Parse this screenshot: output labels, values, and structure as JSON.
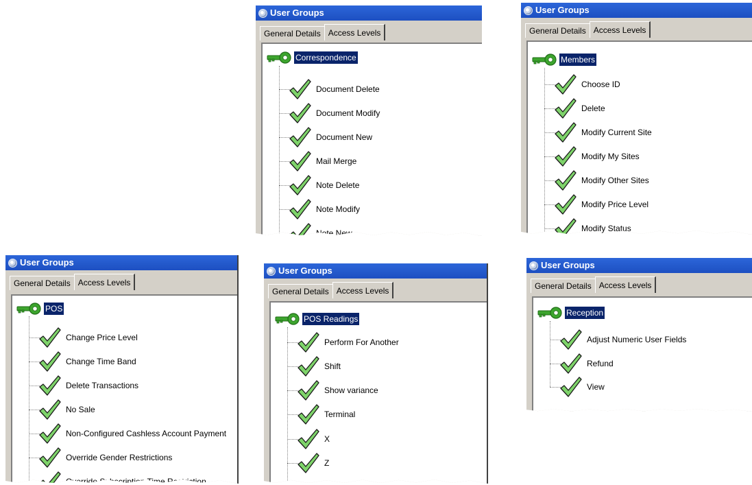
{
  "windows": [
    {
      "id": "correspondence",
      "title": "User Groups",
      "tabs": [
        "General Details",
        "Access Levels"
      ],
      "active_tab": "Access Levels",
      "root": "Correspondence",
      "items": [
        "Document Delete",
        "Document Modify",
        "Document New",
        "Mail Merge",
        "Note Delete",
        "Note Modify",
        "Note New"
      ]
    },
    {
      "id": "members",
      "title": "User Groups",
      "tabs": [
        "General Details",
        "Access Levels"
      ],
      "active_tab": "Access Levels",
      "root": "Members",
      "items": [
        "Choose ID",
        "Delete",
        "Modify Current Site",
        "Modify My Sites",
        "Modify Other Sites",
        "Modify Price Level",
        "Modify Status"
      ]
    },
    {
      "id": "pos",
      "title": "User Groups",
      "tabs": [
        "General Details",
        "Access Levels"
      ],
      "active_tab": "Access Levels",
      "root": "POS",
      "items": [
        "Change Price Level",
        "Change Time Band",
        "Delete Transactions",
        "No Sale",
        "Non-Configured Cashless Account Payment",
        "Override Gender Restrictions",
        "Override Subscription Time Restriction"
      ]
    },
    {
      "id": "pos-readings",
      "title": "User Groups",
      "tabs": [
        "General Details",
        "Access Levels"
      ],
      "active_tab": "Access Levels",
      "root": "POS Readings",
      "items": [
        "Perform For Another",
        "Shift",
        "Show variance",
        "Terminal",
        "X",
        "Z"
      ]
    },
    {
      "id": "reception",
      "title": "User Groups",
      "tabs": [
        "General Details",
        "Access Levels"
      ],
      "active_tab": "Access Levels",
      "root": "Reception",
      "items": [
        "Adjust Numeric User Fields",
        "Refund",
        "View"
      ]
    }
  ],
  "icons": {
    "root": "key-icon",
    "item": "checkmark-icon",
    "title": "app-icon"
  },
  "colors": {
    "titlebar": "#2059cf",
    "selection": "#0a246a",
    "check": "#5db84a",
    "key": "#3da52e"
  }
}
